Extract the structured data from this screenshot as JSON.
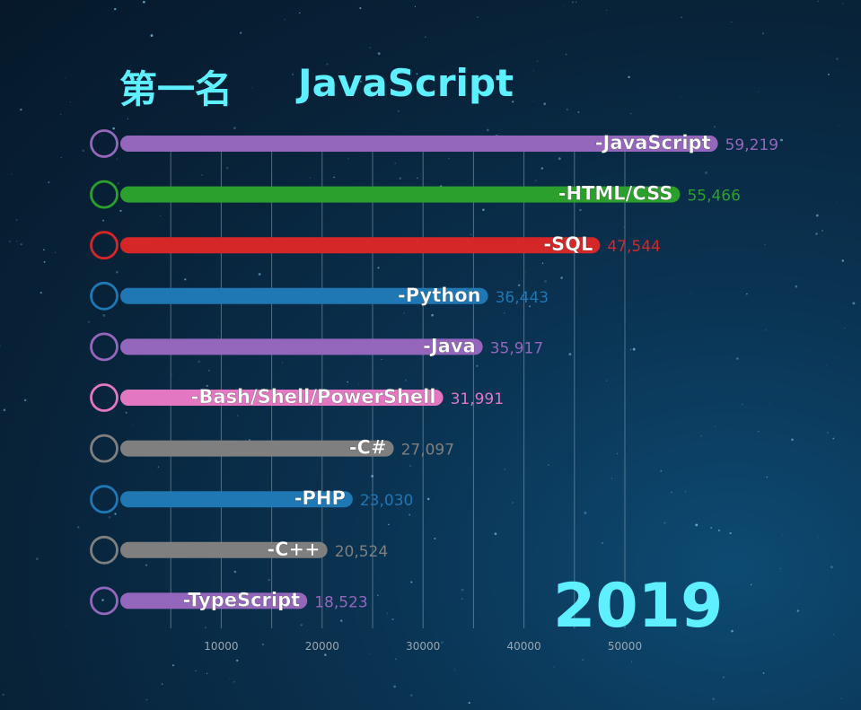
{
  "header": {
    "rank_label": "第一名",
    "leader": "JavaScript"
  },
  "year_label": "2019",
  "chart_data": {
    "type": "bar",
    "orientation": "horizontal",
    "categories": [
      "JavaScript",
      "HTML/CSS",
      "SQL",
      "Python",
      "Java",
      "Bash/Shell/PowerShell",
      "C#",
      "PHP",
      "C++",
      "TypeScript"
    ],
    "bar_labels": [
      "-JavaScript",
      "-HTML/CSS",
      "-SQL",
      "-Python",
      "-Java",
      "-Bash/Shell/PowerShell",
      "-C#",
      "-PHP",
      "-C++",
      "-TypeScript"
    ],
    "values": [
      59219,
      55466,
      47544,
      36443,
      35917,
      31991,
      27097,
      23030,
      20524,
      18523
    ],
    "value_labels": [
      "59,219",
      "55,466",
      "47,544",
      "36,443",
      "35,917",
      "31,991",
      "27,097",
      "23,030",
      "20,524",
      "18,523"
    ],
    "colors": [
      "#9467bd",
      "#2ca02c",
      "#d62728",
      "#1f77b4",
      "#9467bd",
      "#e377c2",
      "#7f7f7f",
      "#1f77b4",
      "#7f7f7f",
      "#9467bd"
    ],
    "x_ticks": [
      10000,
      20000,
      30000,
      40000,
      50000
    ],
    "x_tick_labels": [
      "10000",
      "20000",
      "30000",
      "40000",
      "50000"
    ],
    "xlim": [
      0,
      60000
    ],
    "grid": true,
    "title": "",
    "xlabel": "",
    "ylabel": ""
  }
}
